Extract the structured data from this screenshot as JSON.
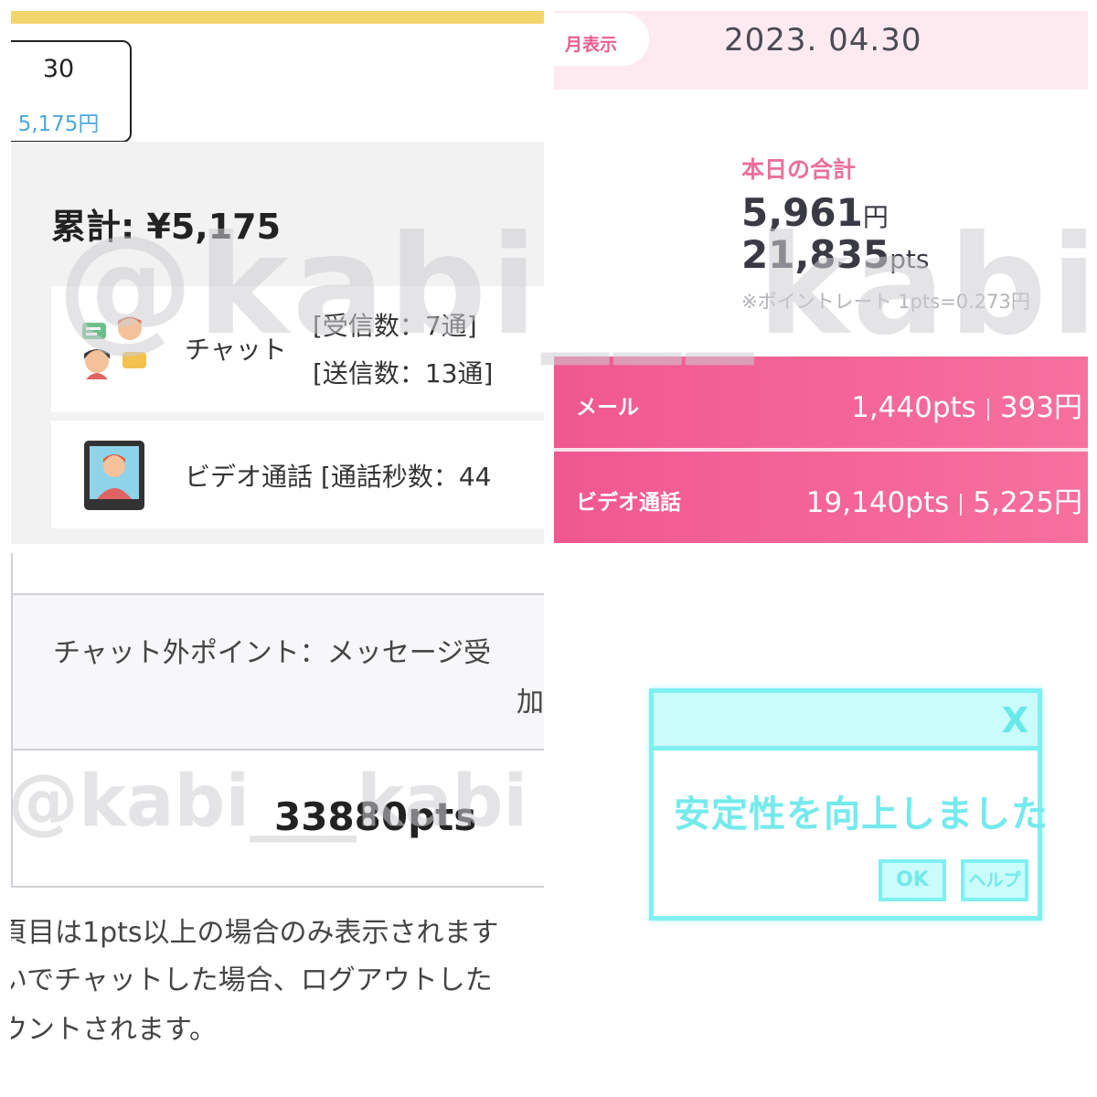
{
  "top_left": {
    "day_number": "30",
    "day_amount": "5,175円",
    "cumulative": "累計: ¥5,175",
    "chat": {
      "label": "チャット",
      "received": "[受信数：7通]",
      "sent": "[送信数：13通]"
    },
    "video": {
      "label": "ビデオ通話 [通話秒数：44"
    }
  },
  "bottom_left": {
    "nonchat_line1": "チャット外ポイント：メッセージ受",
    "nonchat_line2": "加",
    "total_pts": "33880pts",
    "notes": [
      "頁目は1pts以上の場合のみ表示されます",
      "いでチャットした場合、ログアウトした",
      "ウントされます。"
    ]
  },
  "top_right": {
    "month_tab": "月表示",
    "date": "2023. 04.30",
    "today_title": "本日の合計",
    "today_yen_value": "5,961",
    "today_yen_unit": "円",
    "today_pts_value": "21,835",
    "today_pts_unit": "pts",
    "rate_note": "※ポイントレート 1pts=0.273円",
    "rows": [
      {
        "name": "メール",
        "pts": "1,440pts",
        "yen": "393円"
      },
      {
        "name": "ビデオ通話",
        "pts": "19,140pts",
        "yen": "5,225円"
      }
    ]
  },
  "dialog": {
    "close": "X",
    "message": "安定性を向上しました",
    "ok": "OK",
    "help": "ヘルプ"
  },
  "watermark": "@kabi___kabi",
  "colors": {
    "accent_pink": "#f0588f",
    "accent_cyan": "#7ff0f0",
    "band_yellow": "#f3d56e",
    "link_blue": "#4ea7dd"
  }
}
